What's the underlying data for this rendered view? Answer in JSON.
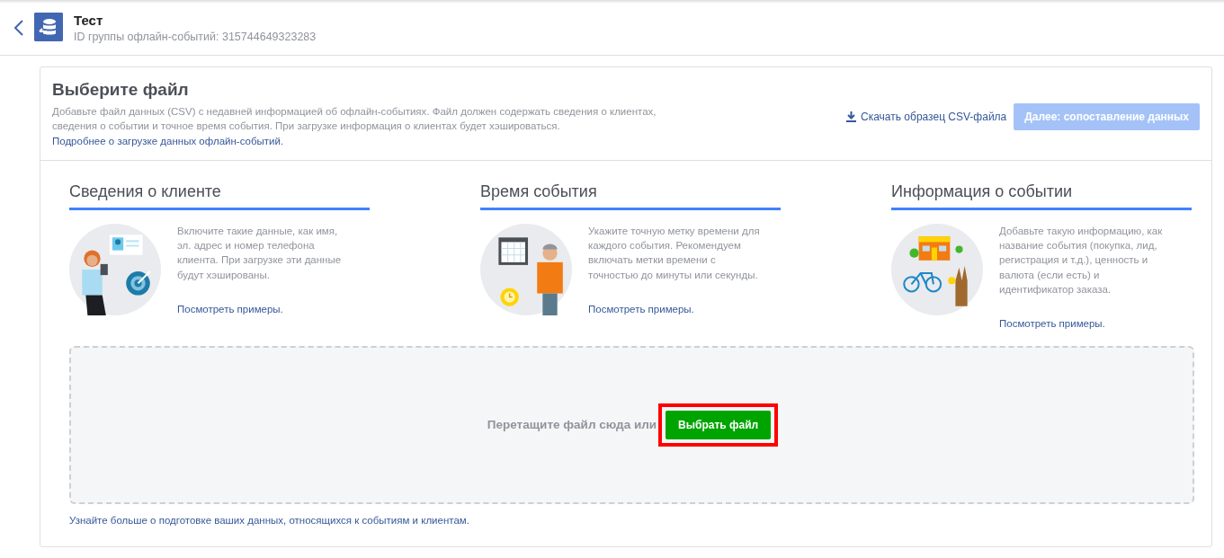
{
  "header": {
    "title": "Тест",
    "subtitle": "ID группы офлайн-событий: 315744649323283"
  },
  "panel": {
    "title": "Выберите файл",
    "description": "Добавьте файл данных (CSV) с недавней информацией об офлайн-событиях. Файл должен содержать сведения о клиентах, сведения о событии и точное время события. При загрузке информация о клиентах будет хэшироваться.",
    "more_link": "Подробнее о загрузке данных офлайн-событий.",
    "download_link": "Скачать образец CSV-файла",
    "next_button": {
      "label": "Далее: сопоставление данных",
      "disabled": true
    }
  },
  "columns": [
    {
      "kind": "customer",
      "title": "Сведения о клиенте",
      "text": "Включите такие данные, как имя, эл. адрес и номер телефона клиента. При загрузке эти данные будут хэшированы.",
      "link": "Посмотреть примеры."
    },
    {
      "kind": "time",
      "title": "Время события",
      "text": "Укажите точную метку времени для каждого события. Рекомендуем включать метки времени с точностью до минуты или секунды.",
      "link": "Посмотреть примеры."
    },
    {
      "kind": "event",
      "title": "Информация о событии",
      "text": "Добавьте такую информацию, как название события (покупка, лид, регистрация и т.д.), ценность и валюта (если есть) и идентификатор заказа.",
      "link": "Посмотреть примеры."
    }
  ],
  "dropzone": {
    "text": "Перетащите файл сюда или",
    "button": {
      "label": "Выбрать файл",
      "highlighted": true
    }
  },
  "footer_link": "Узнайте больше о подготовке ваших данных, относящихся к событиям и клиентам."
}
